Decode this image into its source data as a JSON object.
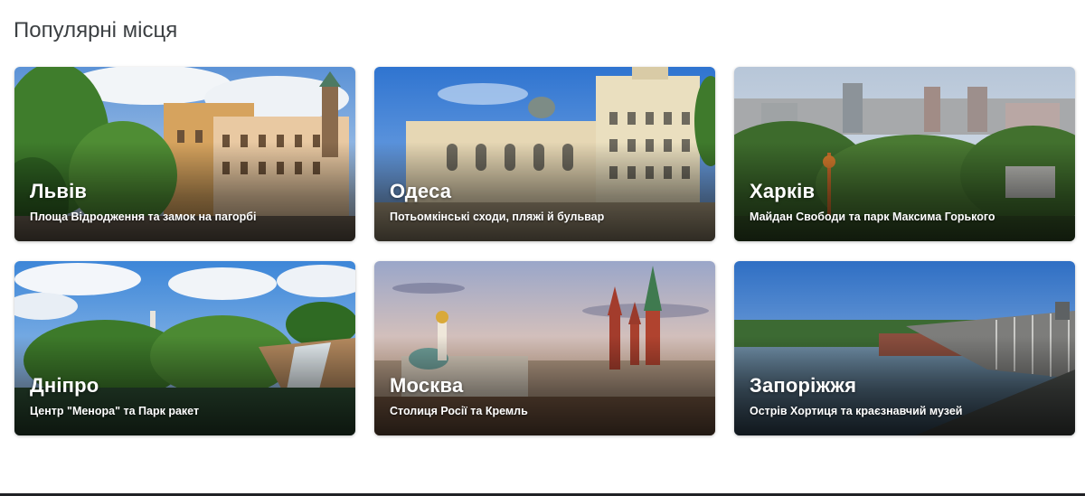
{
  "section": {
    "title": "Популярні місця"
  },
  "places": [
    {
      "name": "Львів",
      "description": "Площа Відродження та замок на пагорбі"
    },
    {
      "name": "Одеса",
      "description": "Потьомкінські сходи, пляжі й бульвар"
    },
    {
      "name": "Харків",
      "description": "Майдан Свободи та парк Максима Горького"
    },
    {
      "name": "Дніпро",
      "description": "Центр \"Менора\" та Парк ракет"
    },
    {
      "name": "Москва",
      "description": "Столиця Росії та Кремль"
    },
    {
      "name": "Запоріжжя",
      "description": "Острів Хортиця та краєзнавчий музей"
    }
  ]
}
